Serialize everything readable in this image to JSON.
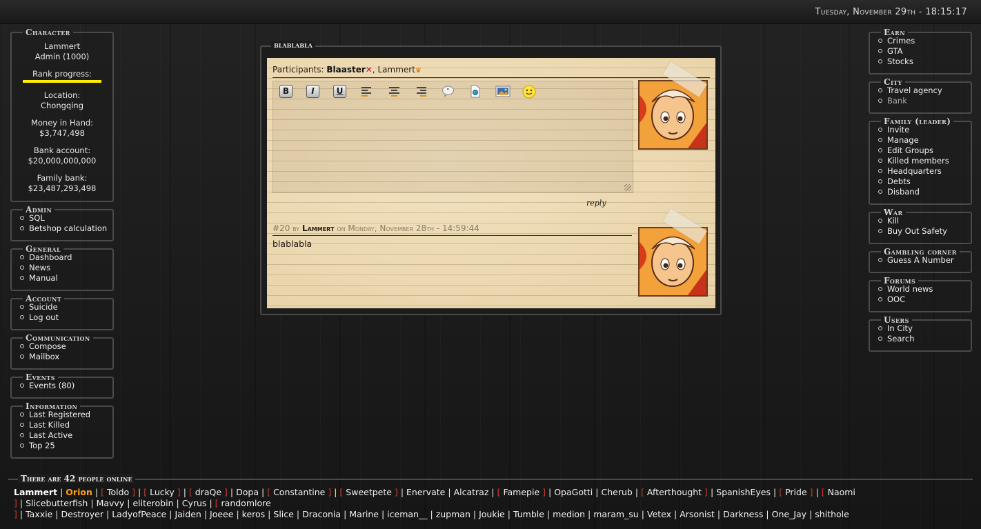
{
  "datetime": "Tuesday, November 29th - 18:15:17",
  "left": {
    "character": {
      "title": "Character",
      "name": "Lammert",
      "role": "Admin (1000)",
      "rank_label": "Rank progress:",
      "rank_progress": 1.0,
      "location_label": "Location:",
      "location": "Chongqing",
      "money_label": "Money in Hand:",
      "money": "$3,747,498",
      "bank_label": "Bank account:",
      "bank": "$20,000,000,000",
      "family_bank_label": "Family bank:",
      "family_bank": "$23,487,293,498"
    },
    "admin": {
      "title": "Admin",
      "items": [
        "SQL",
        "Betshop calculation"
      ]
    },
    "general": {
      "title": "General",
      "items": [
        "Dashboard",
        "News",
        "Manual"
      ]
    },
    "account": {
      "title": "Account",
      "items": [
        "Suicide",
        "Log out"
      ]
    },
    "communication": {
      "title": "Communication",
      "items": [
        "Compose",
        "Mailbox"
      ]
    },
    "events": {
      "title": "Events",
      "items": [
        "Events (80)"
      ]
    },
    "information": {
      "title": "Information",
      "items": [
        "Last Registered",
        "Last Killed",
        "Last Active",
        "Top 25"
      ]
    }
  },
  "right": {
    "earn": {
      "title": "Earn",
      "items": [
        "Crimes",
        "GTA",
        "Stocks"
      ]
    },
    "city": {
      "title": "City",
      "items": [
        "Travel agency",
        "Bank"
      ]
    },
    "family": {
      "title": "Family (leader)",
      "items": [
        "Invite",
        "Manage",
        "Edit Groups",
        "Killed members",
        "Headquarters",
        "Debts",
        "Disband"
      ]
    },
    "war": {
      "title": "War",
      "items": [
        "Kill",
        "Buy Out Safety"
      ]
    },
    "gambling": {
      "title": "Gambling corner",
      "items": [
        "Guess A Number"
      ]
    },
    "forums": {
      "title": "Forums",
      "items": [
        "World news",
        "OOC"
      ]
    },
    "users": {
      "title": "Users",
      "items": [
        "In City",
        "Search"
      ]
    }
  },
  "conversation": {
    "title": "blablabla",
    "participants_label": "Participants:",
    "participant_1": "Blaaster",
    "participant_sep": ",",
    "participant_2": "Lammert",
    "reply_label": "reply",
    "toolbar": {
      "bold": "B",
      "italic": "I",
      "underline": "U",
      "icons": [
        "bold-icon",
        "italic-icon",
        "underline-icon",
        "align-left-icon",
        "align-center-icon",
        "align-right-icon",
        "quote-icon",
        "link-icon",
        "image-icon",
        "smiley-icon"
      ]
    },
    "post": {
      "number": "#20",
      "by": "by",
      "author": "Lammert",
      "on": "on",
      "date": "Monday, November 28th - 14:59:44",
      "body": "blablabla"
    }
  },
  "online": {
    "title": "There are 42 people online",
    "users": [
      {
        "name": "Lammert",
        "kind": "me"
      },
      {
        "name": "Orion",
        "kind": "hl"
      },
      {
        "name": "Toldo",
        "kind": "br"
      },
      {
        "name": "Lucky",
        "kind": "br"
      },
      {
        "name": "draQe",
        "kind": "br"
      },
      {
        "name": "Dopa",
        "kind": "plain"
      },
      {
        "name": "Constantine",
        "kind": "br"
      },
      {
        "name": "Sweetpete",
        "kind": "br"
      },
      {
        "name": "Enervate",
        "kind": "plain"
      },
      {
        "name": "Alcatraz",
        "kind": "plain"
      },
      {
        "name": "Famepie",
        "kind": "br"
      },
      {
        "name": "OpaGotti",
        "kind": "plain"
      },
      {
        "name": "Cherub",
        "kind": "plain"
      },
      {
        "name": "Afterthought",
        "kind": "br"
      },
      {
        "name": "SpanishEyes",
        "kind": "plain"
      },
      {
        "name": "Pride",
        "kind": "br"
      },
      {
        "name": "Naomi",
        "kind": "br"
      },
      {
        "name": "Slicebutterfish",
        "kind": "plain"
      },
      {
        "name": "Mavvy",
        "kind": "plain"
      },
      {
        "name": "eliterobin",
        "kind": "plain"
      },
      {
        "name": "Cyrus",
        "kind": "plain"
      },
      {
        "name": "randomlore",
        "kind": "br"
      },
      {
        "name": "Taxxie",
        "kind": "plain"
      },
      {
        "name": "Destroyer",
        "kind": "plain"
      },
      {
        "name": "LadyofPeace",
        "kind": "plain"
      },
      {
        "name": "Jaiden",
        "kind": "plain"
      },
      {
        "name": "Joeee",
        "kind": "plain"
      },
      {
        "name": "keros",
        "kind": "plain"
      },
      {
        "name": "Slice",
        "kind": "plain"
      },
      {
        "name": "Draconia",
        "kind": "plain"
      },
      {
        "name": "Marine",
        "kind": "plain"
      },
      {
        "name": "iceman__",
        "kind": "plain"
      },
      {
        "name": "zupman",
        "kind": "plain"
      },
      {
        "name": "Joukie",
        "kind": "plain"
      },
      {
        "name": "Tumble",
        "kind": "plain"
      },
      {
        "name": "medion",
        "kind": "plain"
      },
      {
        "name": "maram_su",
        "kind": "plain"
      },
      {
        "name": "Vetex",
        "kind": "plain"
      },
      {
        "name": "Arsonist",
        "kind": "plain"
      },
      {
        "name": "Darkness",
        "kind": "plain"
      },
      {
        "name": "One_Jay",
        "kind": "plain"
      },
      {
        "name": "shithole",
        "kind": "plain"
      }
    ],
    "bracket_open": "[",
    "bracket_close": "]",
    "separator": "|"
  },
  "colors": {
    "accent_orange": "#ff9f1c",
    "bracket_red": "#d23b2a",
    "rank_bar": "#ffee00"
  }
}
